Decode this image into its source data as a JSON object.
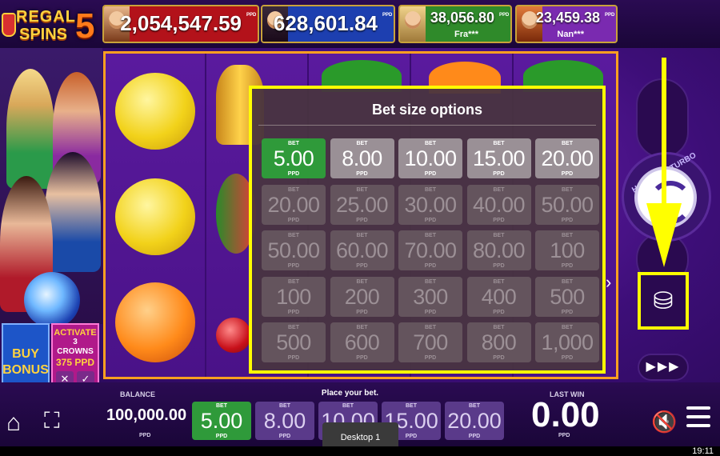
{
  "game": {
    "logo_line1": "REGAL",
    "logo_line2": "SPINS",
    "logo_number": "5"
  },
  "jackpots": [
    {
      "amount": "2,054,547.59",
      "currency": "PPD",
      "color": "#b3121a"
    },
    {
      "amount": "628,601.84",
      "currency": "PPD",
      "color": "#1d3fb0"
    },
    {
      "amount": "38,056.80",
      "player": "Fra***",
      "currency": "PPD",
      "color": "#2f8a2a"
    },
    {
      "amount": "23,459.38",
      "player": "Nan***",
      "currency": "PPD",
      "color": "#7a2ab0"
    }
  ],
  "left_panel": {
    "buy_bonus": "BUY BONUS",
    "activate_title": "ACTIVATE",
    "activate_count": "3",
    "activate_item": "CROWNS",
    "activate_price": "375 PPD",
    "close_icon": "✕",
    "confirm_icon": "✓"
  },
  "bet_dialog": {
    "title": "Bet size options",
    "bet_label": "BET",
    "currency": "PPD",
    "rows": [
      [
        "5.00",
        "8.00",
        "10.00",
        "15.00",
        "20.00"
      ],
      [
        "20.00",
        "25.00",
        "30.00",
        "40.00",
        "50.00"
      ],
      [
        "50.00",
        "60.00",
        "70.00",
        "80.00",
        "100"
      ],
      [
        "100",
        "200",
        "300",
        "400",
        "500"
      ],
      [
        "500",
        "600",
        "700",
        "800",
        "1,000"
      ]
    ],
    "selected": "5.00",
    "highlight_color": "#ffff00"
  },
  "right_panel": {
    "turbo_text": "HOLD FOR TURBO SPIN",
    "autoplay_icon": "▶▶▶",
    "coins_icon": "coins-icon"
  },
  "bottom": {
    "balance_label": "BALANCE",
    "balance_value": "100,000.00",
    "balance_currency": "PPD",
    "place_bet_text": "Place your bet.",
    "bet_label": "BET",
    "currency": "PPD",
    "bets": [
      "5.00",
      "8.00",
      "10.00",
      "15.00",
      "20.00"
    ],
    "last_win_label": "LAST WIN",
    "last_win_value": "0.00",
    "last_win_currency": "PPD"
  },
  "taskbar": {
    "desktop_label": "Desktop 1",
    "clock": "19:11"
  }
}
